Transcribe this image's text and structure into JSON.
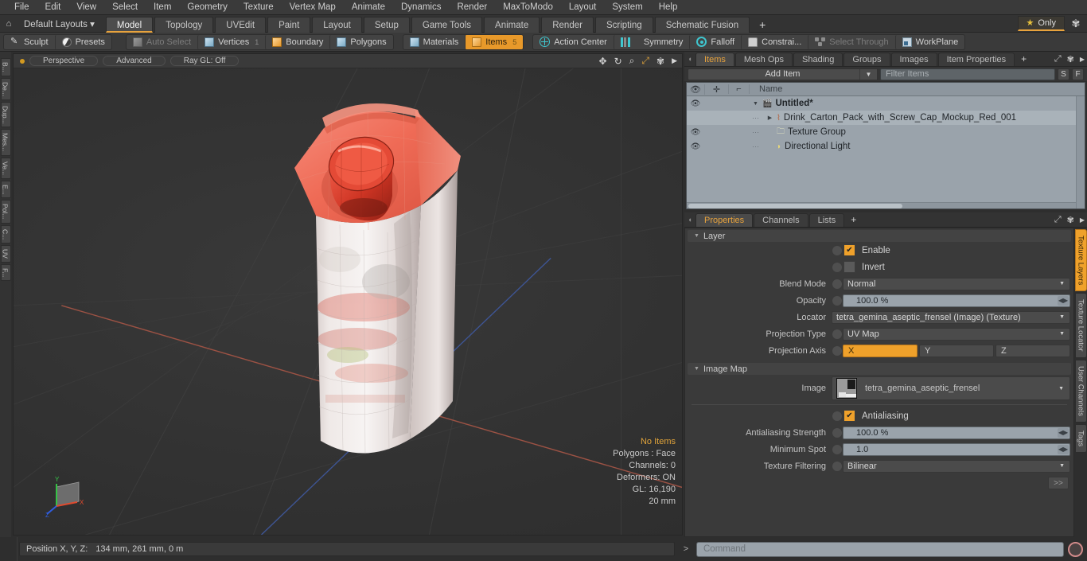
{
  "menubar": {
    "items": [
      "File",
      "Edit",
      "View",
      "Select",
      "Item",
      "Geometry",
      "Texture",
      "Vertex Map",
      "Animate",
      "Dynamics",
      "Render",
      "MaxToModo",
      "Layout",
      "System",
      "Help"
    ]
  },
  "layoutbar": {
    "home_icon": "home-icon",
    "layout_name": "Default Layouts ▾",
    "tabs": [
      {
        "label": "Model",
        "active": true
      },
      {
        "label": "Topology",
        "active": false
      },
      {
        "label": "UVEdit",
        "active": false
      },
      {
        "label": "Paint",
        "active": false
      },
      {
        "label": "Layout",
        "active": false
      },
      {
        "label": "Setup",
        "active": false
      },
      {
        "label": "Game Tools",
        "active": false
      },
      {
        "label": "Animate",
        "active": false
      },
      {
        "label": "Render",
        "active": false
      },
      {
        "label": "Scripting",
        "active": false
      },
      {
        "label": "Schematic Fusion",
        "active": false
      }
    ],
    "add_tab": "+",
    "only_label": "Only",
    "star_glyph": "★",
    "gear_glyph": "✾"
  },
  "toolbar": {
    "group1": [
      {
        "label": "Sculpt",
        "icon": "pencil-icon",
        "state": "normal",
        "badge": ""
      },
      {
        "label": "Presets",
        "icon": "sphere-icon",
        "state": "normal",
        "badge": ""
      }
    ],
    "group2": [
      {
        "label": "Auto Select",
        "icon": "cube-grey-icon",
        "state": "dim",
        "badge": ""
      },
      {
        "label": "Vertices",
        "icon": "cube-blue-icon",
        "state": "normal",
        "badge": "1"
      },
      {
        "label": "Boundary",
        "icon": "boundary-icon",
        "state": "normal",
        "badge": ""
      },
      {
        "label": "Polygons",
        "icon": "cube-blue-icon",
        "state": "normal",
        "badge": ""
      }
    ],
    "group3": [
      {
        "label": "Materials",
        "icon": "cube-blue-icon",
        "state": "normal",
        "badge": ""
      },
      {
        "label": "Items",
        "icon": "cube-orange-icon",
        "state": "on",
        "badge": "5"
      }
    ],
    "group4": [
      {
        "label": "Action Center",
        "icon": "action-center-icon",
        "state": "normal",
        "badge": ""
      },
      {
        "label": "Symmetry",
        "icon": "symmetry-icon",
        "state": "normal",
        "badge": ""
      },
      {
        "label": "Falloff",
        "icon": "falloff-icon",
        "state": "normal",
        "badge": ""
      },
      {
        "label": "Constrai...",
        "icon": "constraint-icon",
        "state": "normal",
        "badge": ""
      },
      {
        "label": "Select Through",
        "icon": "select-through-icon",
        "state": "dim",
        "badge": ""
      },
      {
        "label": "WorkPlane",
        "icon": "workplane-icon",
        "state": "normal",
        "badge": ""
      }
    ]
  },
  "left_rail": {
    "tabs": [
      "B...",
      "De...",
      "Dup...",
      "Mes...",
      "Ve...",
      "E...",
      "Pol...",
      "C...",
      "UV",
      "F..."
    ]
  },
  "viewport": {
    "dot": "viewport-active-dot",
    "pills": [
      "Perspective",
      "Advanced",
      "Ray GL: Off"
    ],
    "tool_icons": [
      "move-icon",
      "rotate-icon",
      "zoom-icon",
      "fit-icon",
      "gear-icon",
      "play-icon"
    ],
    "stats": {
      "selection": "No Items",
      "polygons": "Polygons : Face",
      "channels": "Channels: 0",
      "deformers": "Deformers: ON",
      "gl": "GL: 16,190",
      "scale": "20 mm"
    },
    "gizmo": {
      "x": "X",
      "y": "Y",
      "z": "Z"
    },
    "model": "Drink carton pack with red screw cap"
  },
  "items_panel": {
    "tabs": [
      {
        "label": "Items",
        "active": true
      },
      {
        "label": "Mesh Ops",
        "active": false
      },
      {
        "label": "Shading",
        "active": false
      },
      {
        "label": "Groups",
        "active": false
      },
      {
        "label": "Images",
        "active": false
      },
      {
        "label": "Item Properties",
        "active": false
      }
    ],
    "add_tab": "+",
    "add_item_label": "Add Item",
    "filter_placeholder": "Filter Items",
    "btn_s": "S",
    "btn_f": "F",
    "columns": {
      "eye": "eye-icon",
      "add": "add-icon",
      "axis": "axis-icon",
      "name": "Name"
    },
    "rows": [
      {
        "name": "Untitled*",
        "eye": true,
        "depth": 0,
        "triangle": "▼",
        "bold": true,
        "icon": "scene-icon",
        "selected": false
      },
      {
        "name": "Drink_Carton_Pack_with_Screw_Cap_Mockup_Red_001",
        "eye": false,
        "depth": 1,
        "triangle": "▶",
        "bold": false,
        "icon": "mesh-icon",
        "selected": true
      },
      {
        "name": "Texture Group",
        "eye": true,
        "depth": 1,
        "triangle": "",
        "bold": false,
        "icon": "folder-icon",
        "selected": false
      },
      {
        "name": "Directional Light",
        "eye": true,
        "depth": 1,
        "triangle": "",
        "bold": false,
        "icon": "light-icon",
        "selected": false
      }
    ]
  },
  "properties_panel": {
    "tabs": [
      {
        "label": "Properties",
        "active": true
      },
      {
        "label": "Channels",
        "active": false
      },
      {
        "label": "Lists",
        "active": false
      }
    ],
    "add_tab": "+",
    "sections": {
      "layer": {
        "title": "Layer",
        "enable": {
          "label": "Enable",
          "checked": true
        },
        "invert": {
          "label": "Invert",
          "checked": false
        },
        "blend_mode": {
          "label": "Blend Mode",
          "value": "Normal"
        },
        "opacity": {
          "label": "Opacity",
          "value": "100.0 %"
        },
        "locator": {
          "label": "Locator",
          "value": "tetra_gemina_aseptic_frensel (Image) (Texture)"
        },
        "projection_type": {
          "label": "Projection Type",
          "value": "UV Map"
        },
        "projection_axis": {
          "label": "Projection Axis",
          "options": [
            "X",
            "Y",
            "Z"
          ],
          "selected": "X"
        }
      },
      "image_map": {
        "title": "Image Map",
        "image": {
          "label": "Image",
          "value": "tetra_gemina_aseptic_frensel"
        },
        "antialiasing": {
          "label": "Antialiasing",
          "checked": true
        },
        "antialiasing_strength": {
          "label": "Antialiasing Strength",
          "value": "100.0 %"
        },
        "minimum_spot": {
          "label": "Minimum Spot",
          "value": "1.0"
        },
        "texture_filtering": {
          "label": "Texture Filtering",
          "value": "Bilinear"
        },
        "more_button": ">>"
      }
    },
    "side_tabs": [
      {
        "label": "Texture Layers",
        "active": true
      },
      {
        "label": "Texture Locator",
        "active": false
      },
      {
        "label": "User Channels",
        "active": false
      },
      {
        "label": "Tags",
        "active": false
      }
    ]
  },
  "statusbar": {
    "position_label": "Position X, Y, Z:",
    "position_value": "134 mm, 261 mm, 0 m",
    "command_caret": ">",
    "command_placeholder": "Command",
    "record_button": "record-icon"
  },
  "colors": {
    "accent": "#efa12b",
    "panel_bg": "#3a3a3a",
    "window_bg": "#2e2e2e",
    "field_light": "#9aa3ab",
    "cap_red": "#e8483a"
  }
}
